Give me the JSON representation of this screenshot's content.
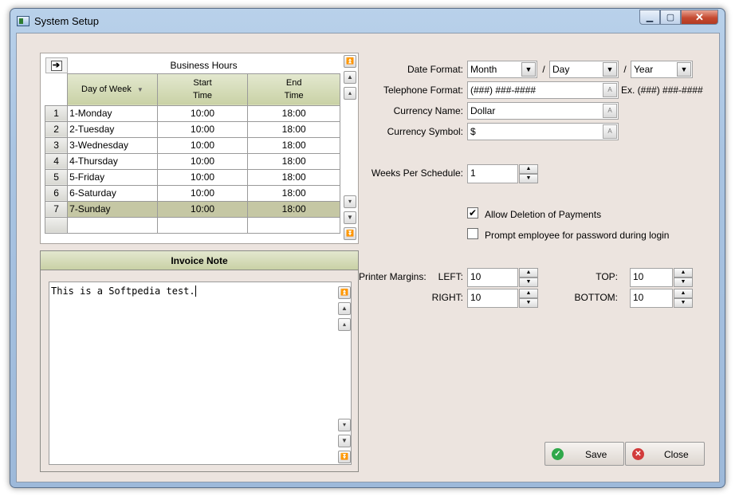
{
  "window": {
    "title": "System Setup"
  },
  "business_hours": {
    "caption": "Business Hours",
    "columns": {
      "day": "Day of Week",
      "start_line1": "Start",
      "start_line2": "Time",
      "end_line1": "End",
      "end_line2": "Time"
    },
    "rows": [
      {
        "num": "1",
        "day": "1-Monday",
        "start": "10:00",
        "end": "18:00"
      },
      {
        "num": "2",
        "day": "2-Tuesday",
        "start": "10:00",
        "end": "18:00"
      },
      {
        "num": "3",
        "day": "3-Wednesday",
        "start": "10:00",
        "end": "18:00"
      },
      {
        "num": "4",
        "day": "4-Thursday",
        "start": "10:00",
        "end": "18:00"
      },
      {
        "num": "5",
        "day": "5-Friday",
        "start": "10:00",
        "end": "18:00"
      },
      {
        "num": "6",
        "day": "6-Saturday",
        "start": "10:00",
        "end": "18:00"
      },
      {
        "num": "7",
        "day": "7-Sunday",
        "start": "10:00",
        "end": "18:00"
      }
    ]
  },
  "invoice_note": {
    "title": "Invoice Note",
    "text": "This is a Softpedia test."
  },
  "form": {
    "date_format_label": "Date Format:",
    "date_month": "Month",
    "date_day": "Day",
    "date_year": "Year",
    "date_sep": "/",
    "telephone_label": "Telephone Format:",
    "telephone_value": "(###) ###-####",
    "telephone_example": "Ex. (###) ###-####",
    "currency_name_label": "Currency Name:",
    "currency_name_value": "Dollar",
    "currency_symbol_label": "Currency Symbol:",
    "currency_symbol_value": "$",
    "weeks_label": "Weeks Per Schedule:",
    "weeks_value": "1",
    "allow_deletion_label": "Allow Deletion of Payments",
    "allow_deletion_checked": true,
    "prompt_password_label": "Prompt employee for password during login",
    "prompt_password_checked": false,
    "printer_margins_label": "Printer Margins:",
    "left_label": "LEFT:",
    "left_value": "10",
    "top_label": "TOP:",
    "top_value": "10",
    "right_label": "RIGHT:",
    "right_value": "10",
    "bottom_label": "BOTTOM:",
    "bottom_value": "10"
  },
  "buttons": {
    "save": "Save",
    "close": "Close"
  },
  "colors": {
    "window_bg": "#ece4df",
    "header_olive": "#c9d1a5",
    "selected_row": "#c5c7a4"
  }
}
